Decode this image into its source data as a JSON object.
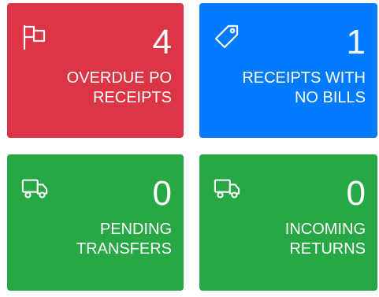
{
  "tiles": [
    {
      "count": "4",
      "label_line1": "OVERDUE PO",
      "label_line2": "RECEIPTS",
      "icon": "flag-icon",
      "color": "#dc3545"
    },
    {
      "count": "1",
      "label_line1": "RECEIPTS WITH",
      "label_line2": "NO BILLS",
      "icon": "tag-icon",
      "color": "#007bff"
    },
    {
      "count": "0",
      "label_line1": "PENDING",
      "label_line2": "TRANSFERS",
      "icon": "truck-icon",
      "color": "#28a745"
    },
    {
      "count": "0",
      "label_line1": "INCOMING",
      "label_line2": "RETURNS",
      "icon": "truck-icon",
      "color": "#28a745"
    }
  ]
}
